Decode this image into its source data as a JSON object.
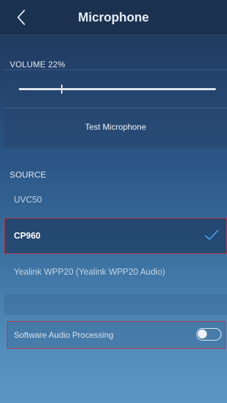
{
  "header": {
    "title": "Microphone",
    "back_icon": "chevron-left-icon"
  },
  "volume": {
    "label": "VOLUME 22%",
    "level_percent": 22,
    "test_button_label": "Test Microphone"
  },
  "source": {
    "label": "SOURCE",
    "items": [
      {
        "label": "UVC50",
        "selected": false
      },
      {
        "label": "CP960",
        "selected": true
      },
      {
        "label": "Yealink WPP20 (Yealink WPP20 Audio)",
        "selected": false
      }
    ],
    "check_icon": "checkmark-icon",
    "check_color": "#4aa3ff"
  },
  "software_audio_processing": {
    "label": "Software Audio Processing",
    "enabled": false
  },
  "colors": {
    "highlight_outline": "#b83a4a",
    "header_bg": "#1b3150"
  }
}
